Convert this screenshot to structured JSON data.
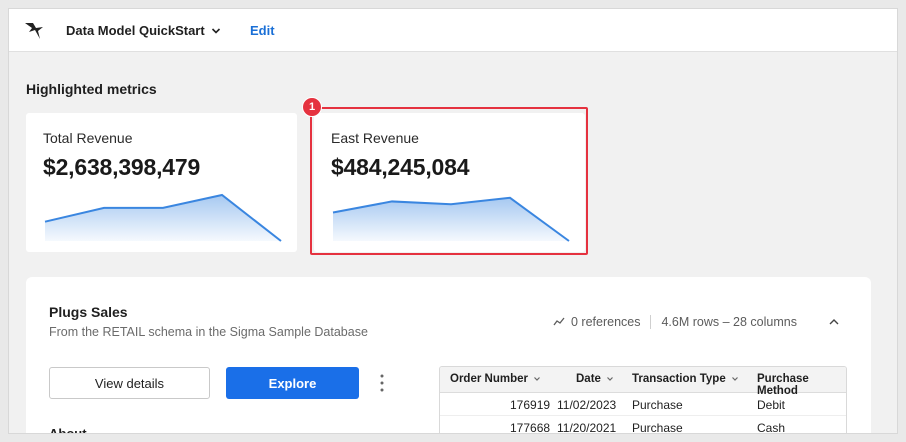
{
  "header": {
    "title": "Data Model QuickStart",
    "edit_label": "Edit"
  },
  "metrics": {
    "section_title": "Highlighted metrics",
    "cards": [
      {
        "label": "Total Revenue",
        "value": "$2,638,398,479",
        "trend": [
          0.42,
          0.72,
          0.72,
          1.0,
          0.0
        ]
      },
      {
        "label": "East Revenue",
        "value": "$484,245,084",
        "trend": [
          0.62,
          0.86,
          0.8,
          0.94,
          0.0
        ]
      }
    ],
    "annotation_number": "1"
  },
  "panel": {
    "title": "Plugs Sales",
    "subtitle": "From the RETAIL schema in the Sigma Sample Database",
    "references": "0 references",
    "size": "4.6M rows – 28 columns",
    "view_details_label": "View details",
    "explore_label": "Explore",
    "about_label": "About",
    "table": {
      "columns": [
        "Order Number",
        "Date",
        "Transaction Type",
        "Purchase Method"
      ],
      "rows": [
        [
          "176919",
          "11/02/2023",
          "Purchase",
          "Debit"
        ],
        [
          "177668",
          "11/20/2021",
          "Purchase",
          "Cash"
        ]
      ]
    }
  },
  "colors": {
    "accent": "#1a6fe8",
    "highlight": "#e5323f",
    "sparkline": "#3a86e0"
  }
}
